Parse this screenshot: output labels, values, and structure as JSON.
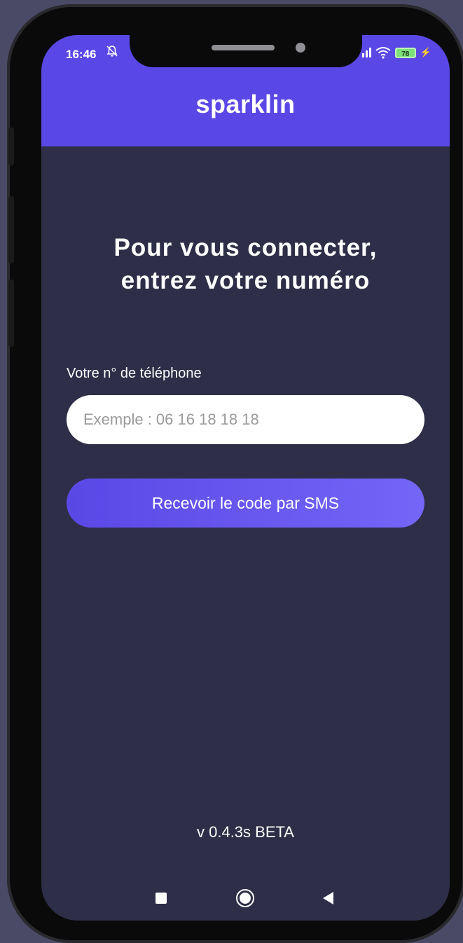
{
  "status_bar": {
    "time": "16:46",
    "battery": "78"
  },
  "header": {
    "brand": "sparklin"
  },
  "login": {
    "headline": "Pour vous connecter, entrez votre numéro",
    "phone_label": "Votre n° de téléphone",
    "phone_value": "",
    "phone_placeholder": "Exemple : 06 16 18 18 18",
    "submit_label": "Recevoir le code par SMS"
  },
  "footer": {
    "version": "v 0.4.3s BETA"
  },
  "icons": {
    "silent": "bell-slash-icon",
    "signal": "signal-icon",
    "wifi": "wifi-icon",
    "battery": "battery-icon",
    "charging": "charging-bolt-icon",
    "recent_apps": "square-icon",
    "home": "circle-icon",
    "back": "back-triangle-icon"
  },
  "colors": {
    "accent": "#5a48e6",
    "background": "#2e2e48",
    "text": "#ffffff"
  }
}
